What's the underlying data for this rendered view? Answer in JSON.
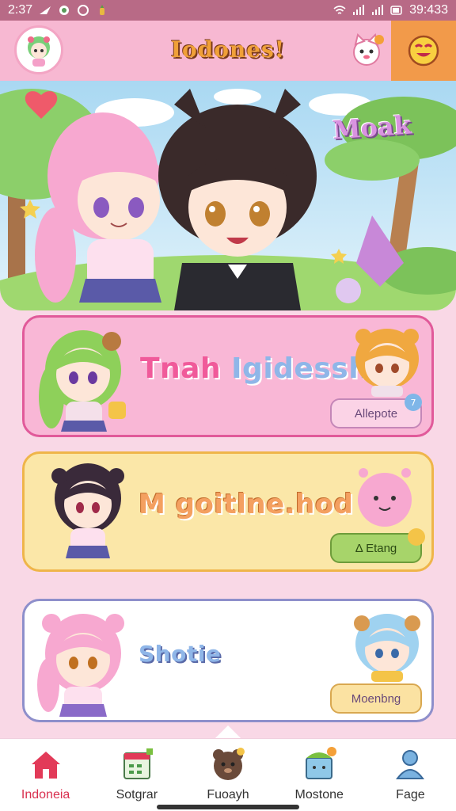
{
  "status_bar": {
    "time": "2:37",
    "clock_right": "39:433"
  },
  "header": {
    "title": "Iodones!",
    "avatar_icon": "girl-avatar-icon",
    "cat_icon": "cat-bell-icon",
    "face_icon": "smile-face-icon"
  },
  "hero": {
    "title": "Moak"
  },
  "cards": [
    {
      "title_a": "Tnah",
      "title_b": "Igidessh",
      "button": "Allepote",
      "badge": "7"
    },
    {
      "title": "M goitlne.hod",
      "button": "Δ Etang",
      "badge": ""
    },
    {
      "title": "Shotie",
      "button": "Moenbng"
    }
  ],
  "nav": [
    {
      "label": "Indoneia",
      "icon": "home-icon",
      "active": true
    },
    {
      "label": "Sotgrar",
      "icon": "calendar-icon",
      "active": false
    },
    {
      "label": "Fuoayh",
      "icon": "bear-icon",
      "active": false
    },
    {
      "label": "Mostone",
      "icon": "gift-icon",
      "active": false
    },
    {
      "label": "Fage",
      "icon": "person-icon",
      "active": false
    }
  ],
  "colors": {
    "accent": "#f7b8d2",
    "active_nav": "#d9304f",
    "face_button": "#f29a4a"
  }
}
